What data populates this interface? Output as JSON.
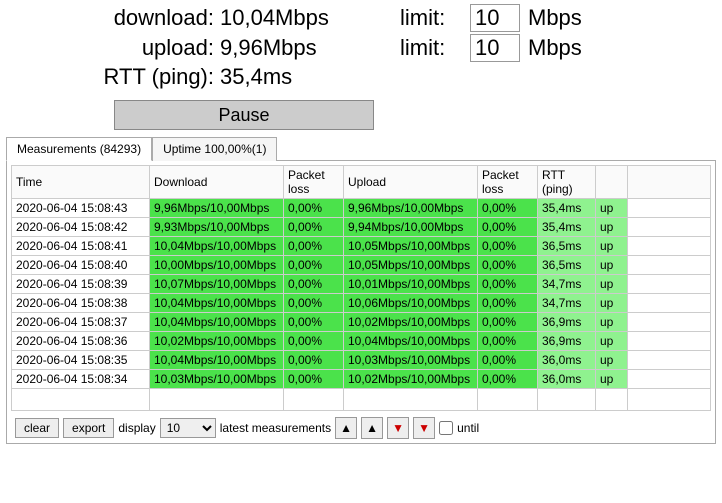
{
  "stats": {
    "download_label": "download:",
    "download_value": "10,04Mbps",
    "download_limit_label": "limit:",
    "download_limit_value": "10",
    "download_limit_unit": "Mbps",
    "upload_label": "upload:",
    "upload_value": "9,96Mbps",
    "upload_limit_label": "limit:",
    "upload_limit_value": "10",
    "upload_limit_unit": "Mbps",
    "rtt_label": "RTT (ping):",
    "rtt_value": "35,4ms"
  },
  "pause_label": "Pause",
  "tabs": {
    "measurements": "Measurements  (84293)",
    "uptime": "Uptime  100,00%(1)"
  },
  "headers": {
    "time": "Time",
    "download": "Download",
    "packet_loss": "Packet loss",
    "upload": "Upload",
    "packet_loss2": "Packet loss",
    "rtt": "RTT (ping)"
  },
  "rows": [
    {
      "time": "2020-06-04 15:08:43",
      "dl": "9,96Mbps/10,00Mbps",
      "pl": "0,00%",
      "ul": "9,96Mbps/10,00Mbps",
      "pl2": "0,00%",
      "rtt": "35,4ms",
      "up": "up"
    },
    {
      "time": "2020-06-04 15:08:42",
      "dl": "9,93Mbps/10,00Mbps",
      "pl": "0,00%",
      "ul": "9,94Mbps/10,00Mbps",
      "pl2": "0,00%",
      "rtt": "35,4ms",
      "up": "up"
    },
    {
      "time": "2020-06-04 15:08:41",
      "dl": "10,04Mbps/10,00Mbps",
      "pl": "0,00%",
      "ul": "10,05Mbps/10,00Mbps",
      "pl2": "0,00%",
      "rtt": "36,5ms",
      "up": "up"
    },
    {
      "time": "2020-06-04 15:08:40",
      "dl": "10,00Mbps/10,00Mbps",
      "pl": "0,00%",
      "ul": "10,05Mbps/10,00Mbps",
      "pl2": "0,00%",
      "rtt": "36,5ms",
      "up": "up"
    },
    {
      "time": "2020-06-04 15:08:39",
      "dl": "10,07Mbps/10,00Mbps",
      "pl": "0,00%",
      "ul": "10,01Mbps/10,00Mbps",
      "pl2": "0,00%",
      "rtt": "34,7ms",
      "up": "up"
    },
    {
      "time": "2020-06-04 15:08:38",
      "dl": "10,04Mbps/10,00Mbps",
      "pl": "0,00%",
      "ul": "10,06Mbps/10,00Mbps",
      "pl2": "0,00%",
      "rtt": "34,7ms",
      "up": "up"
    },
    {
      "time": "2020-06-04 15:08:37",
      "dl": "10,04Mbps/10,00Mbps",
      "pl": "0,00%",
      "ul": "10,02Mbps/10,00Mbps",
      "pl2": "0,00%",
      "rtt": "36,9ms",
      "up": "up"
    },
    {
      "time": "2020-06-04 15:08:36",
      "dl": "10,02Mbps/10,00Mbps",
      "pl": "0,00%",
      "ul": "10,04Mbps/10,00Mbps",
      "pl2": "0,00%",
      "rtt": "36,9ms",
      "up": "up"
    },
    {
      "time": "2020-06-04 15:08:35",
      "dl": "10,04Mbps/10,00Mbps",
      "pl": "0,00%",
      "ul": "10,03Mbps/10,00Mbps",
      "pl2": "0,00%",
      "rtt": "36,0ms",
      "up": "up"
    },
    {
      "time": "2020-06-04 15:08:34",
      "dl": "10,03Mbps/10,00Mbps",
      "pl": "0,00%",
      "ul": "10,02Mbps/10,00Mbps",
      "pl2": "0,00%",
      "rtt": "36,0ms",
      "up": "up"
    }
  ],
  "footer": {
    "clear": "clear",
    "export": "export",
    "display": "display",
    "count": "10",
    "latest": "latest measurements",
    "until": "until"
  }
}
